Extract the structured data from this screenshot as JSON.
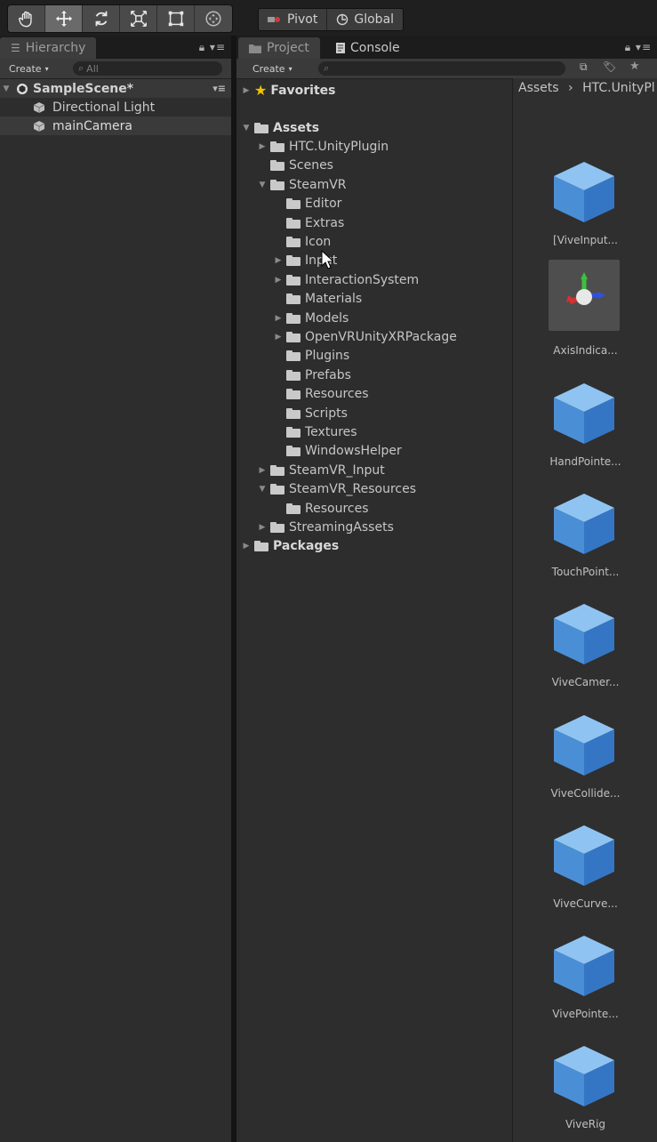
{
  "toolbar": {
    "tools": [
      {
        "name": "hand-tool-icon",
        "active": false
      },
      {
        "name": "move-tool-icon",
        "active": true
      },
      {
        "name": "rotate-tool-icon",
        "active": false
      },
      {
        "name": "scale-tool-icon",
        "active": false
      },
      {
        "name": "rect-tool-icon",
        "active": false
      },
      {
        "name": "transform-tool-icon",
        "active": false
      }
    ],
    "pivot_label": "Pivot",
    "global_label": "Global"
  },
  "hierarchy": {
    "tab_label": "Hierarchy",
    "create_label": "Create",
    "search_placeholder": "All",
    "scene_name": "SampleScene*",
    "objects": [
      "Directional Light",
      "mainCamera"
    ]
  },
  "project": {
    "tab_label": "Project",
    "console_label": "Console",
    "create_label": "Create",
    "favorites_label": "Favorites",
    "tree": [
      {
        "label": "Assets",
        "depth": 0,
        "arrow": "down",
        "bold": true
      },
      {
        "label": "HTC.UnityPlugin",
        "depth": 1,
        "arrow": "right"
      },
      {
        "label": "Scenes",
        "depth": 1,
        "arrow": ""
      },
      {
        "label": "SteamVR",
        "depth": 1,
        "arrow": "down"
      },
      {
        "label": "Editor",
        "depth": 2,
        "arrow": ""
      },
      {
        "label": "Extras",
        "depth": 2,
        "arrow": ""
      },
      {
        "label": "Icon",
        "depth": 2,
        "arrow": ""
      },
      {
        "label": "Input",
        "depth": 2,
        "arrow": "right"
      },
      {
        "label": "InteractionSystem",
        "depth": 2,
        "arrow": "right"
      },
      {
        "label": "Materials",
        "depth": 2,
        "arrow": ""
      },
      {
        "label": "Models",
        "depth": 2,
        "arrow": "right"
      },
      {
        "label": "OpenVRUnityXRPackage",
        "depth": 2,
        "arrow": "right"
      },
      {
        "label": "Plugins",
        "depth": 2,
        "arrow": ""
      },
      {
        "label": "Prefabs",
        "depth": 2,
        "arrow": ""
      },
      {
        "label": "Resources",
        "depth": 2,
        "arrow": ""
      },
      {
        "label": "Scripts",
        "depth": 2,
        "arrow": ""
      },
      {
        "label": "Textures",
        "depth": 2,
        "arrow": ""
      },
      {
        "label": "WindowsHelper",
        "depth": 2,
        "arrow": ""
      },
      {
        "label": "SteamVR_Input",
        "depth": 1,
        "arrow": "right"
      },
      {
        "label": "SteamVR_Resources",
        "depth": 1,
        "arrow": "down"
      },
      {
        "label": "Resources",
        "depth": 2,
        "arrow": ""
      },
      {
        "label": "StreamingAssets",
        "depth": 1,
        "arrow": "right"
      },
      {
        "label": "Packages",
        "depth": 0,
        "arrow": "right",
        "bold": true
      }
    ],
    "breadcrumb": [
      "Assets",
      "HTC.UnityPl"
    ],
    "assets": [
      {
        "label": "[ViveInput...",
        "kind": "prefab"
      },
      {
        "label": "AxisIndica...",
        "kind": "axis"
      },
      {
        "label": "HandPointe...",
        "kind": "prefab"
      },
      {
        "label": "TouchPoint...",
        "kind": "prefab"
      },
      {
        "label": "ViveCamer...",
        "kind": "prefab"
      },
      {
        "label": "ViveCollide...",
        "kind": "prefab"
      },
      {
        "label": "ViveCurve...",
        "kind": "prefab"
      },
      {
        "label": "VivePointe...",
        "kind": "prefab"
      },
      {
        "label": "ViveRig",
        "kind": "prefab"
      }
    ]
  },
  "colors": {
    "cube_top": "#8fc4f2",
    "cube_left": "#4a8fd6",
    "cube_right": "#3576c4",
    "favorites_star": "#f2c200"
  }
}
